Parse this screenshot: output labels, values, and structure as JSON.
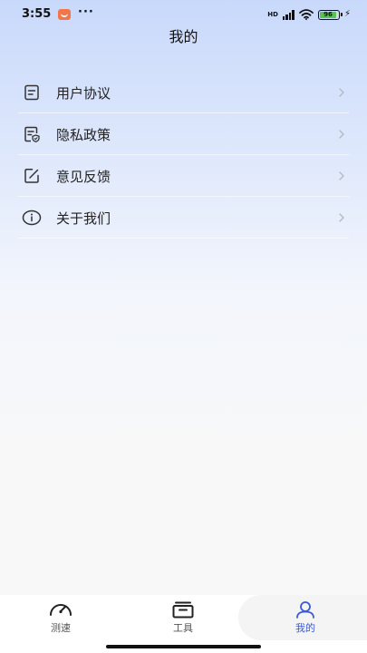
{
  "status_bar": {
    "time": "3:55",
    "more": "···",
    "network_label": "HD",
    "battery_level": "96"
  },
  "header": {
    "title": "我的"
  },
  "menu": {
    "items": [
      {
        "label": "用户协议",
        "icon": "document-icon"
      },
      {
        "label": "隐私政策",
        "icon": "privacy-shield-icon"
      },
      {
        "label": "意见反馈",
        "icon": "edit-icon"
      },
      {
        "label": "关于我们",
        "icon": "info-icon"
      }
    ]
  },
  "tab_bar": {
    "tabs": [
      {
        "label": "测速",
        "icon": "speedometer-icon",
        "active": false
      },
      {
        "label": "工具",
        "icon": "toolbox-icon",
        "active": false
      },
      {
        "label": "我的",
        "icon": "user-icon",
        "active": true
      }
    ]
  },
  "colors": {
    "accent": "#3a5bd9",
    "header_gradient_top": "#c9d9fb",
    "background": "#f8f8f8"
  }
}
